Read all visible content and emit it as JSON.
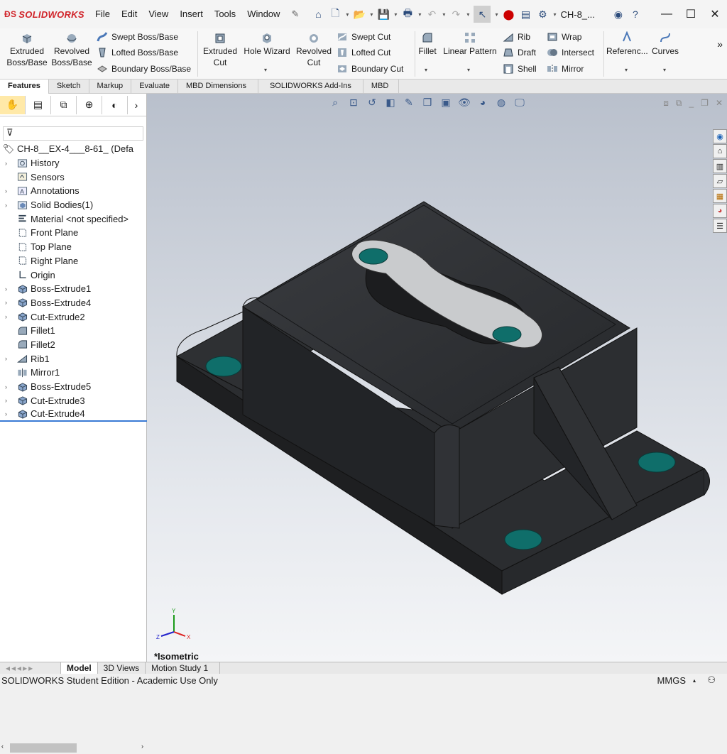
{
  "app": {
    "brand": "SOLIDWORKS",
    "title": "CH-8_..."
  },
  "menu": [
    "File",
    "Edit",
    "View",
    "Insert",
    "Tools",
    "Window"
  ],
  "ribbon": {
    "extruded_boss": "Extruded Boss/Base",
    "revolved_boss": "Revolved Boss/Base",
    "swept_boss": "Swept Boss/Base",
    "lofted_boss": "Lofted Boss/Base",
    "boundary_boss": "Boundary Boss/Base",
    "extruded_cut": "Extruded Cut",
    "hole_wizard": "Hole Wizard",
    "revolved_cut": "Revolved Cut",
    "swept_cut": "Swept Cut",
    "lofted_cut": "Lofted Cut",
    "boundary_cut": "Boundary Cut",
    "fillet": "Fillet",
    "linear_pattern": "Linear Pattern",
    "rib": "Rib",
    "draft": "Draft",
    "shell": "Shell",
    "wrap": "Wrap",
    "intersect": "Intersect",
    "mirror": "Mirror",
    "reference": "Referenc...",
    "curves": "Curves"
  },
  "tabs": [
    "Features",
    "Sketch",
    "Markup",
    "Evaluate",
    "MBD Dimensions",
    "SOLIDWORKS Add-Ins",
    "MBD"
  ],
  "tree": {
    "root": "CH-8__EX-4___8-61_ (Defa",
    "items": [
      {
        "label": "History",
        "expand": true
      },
      {
        "label": "Sensors",
        "expand": false
      },
      {
        "label": "Annotations",
        "expand": true
      },
      {
        "label": "Solid Bodies(1)",
        "expand": true
      },
      {
        "label": "Material <not specified>",
        "expand": false
      },
      {
        "label": "Front Plane",
        "expand": false
      },
      {
        "label": "Top Plane",
        "expand": false
      },
      {
        "label": "Right Plane",
        "expand": false
      },
      {
        "label": "Origin",
        "expand": false
      },
      {
        "label": "Boss-Extrude1",
        "expand": true
      },
      {
        "label": "Boss-Extrude4",
        "expand": true
      },
      {
        "label": "Cut-Extrude2",
        "expand": true
      },
      {
        "label": "Fillet1",
        "expand": false
      },
      {
        "label": "Fillet2",
        "expand": false
      },
      {
        "label": "Rib1",
        "expand": true
      },
      {
        "label": "Mirror1",
        "expand": false
      },
      {
        "label": "Boss-Extrude5",
        "expand": true
      },
      {
        "label": "Cut-Extrude3",
        "expand": true
      },
      {
        "label": "Cut-Extrude4",
        "expand": true
      }
    ]
  },
  "viewport": {
    "view_label": "*Isometric"
  },
  "bottom_tabs": [
    "Model",
    "3D Views",
    "Motion Study 1"
  ],
  "status": {
    "left": "SOLIDWORKS Student Edition - Academic Use Only",
    "units": "MMGS"
  },
  "colors": {
    "accent": "#d1242a",
    "part": "#2b2d30",
    "hole": "#0f6e6a",
    "plate": "#c9cbcd"
  }
}
